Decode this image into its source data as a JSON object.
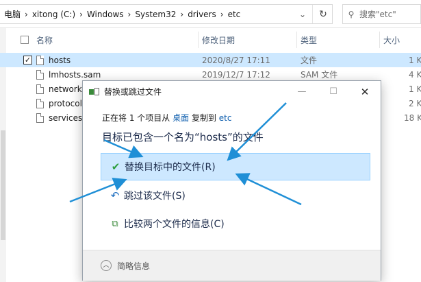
{
  "address": {
    "crumbs": [
      "电脑",
      "xitong (C:)",
      "Windows",
      "System32",
      "drivers",
      "etc"
    ],
    "search_placeholder": "搜索\"etc\""
  },
  "columns": {
    "name": "名称",
    "date": "修改日期",
    "type": "类型",
    "size": "大小"
  },
  "files": [
    {
      "name": "hosts",
      "date": "2020/8/27 17:11",
      "type": "文件",
      "size": "1 K",
      "selected": true
    },
    {
      "name": "lmhosts.sam",
      "date": "2019/12/7 17:12",
      "type": "SAM 文件",
      "size": "4 K"
    },
    {
      "name": "networks",
      "date": "",
      "type": "",
      "size": "1 K"
    },
    {
      "name": "protocol",
      "date": "",
      "type": "",
      "size": "2 K"
    },
    {
      "name": "services",
      "date": "",
      "type": "",
      "size": "18 K"
    }
  ],
  "dialog": {
    "title": "替换或跳过文件",
    "line_prefix": "正在将 1 个项目从",
    "source": "桌面",
    "line_middle": "复制到",
    "dest": "etc",
    "heading": "目标已包含一个名为“hosts”的文件",
    "replace_label": "替换目标中的文件(R)",
    "skip_label": "跳过该文件(S)",
    "compare_label": "比较两个文件的信息(C)",
    "details_label": "简略信息"
  },
  "colors": {
    "accent_blue": "#0b5cad",
    "selection": "#cde8ff",
    "arrow": "#1f8fd6",
    "check_green": "#2e9e3e"
  }
}
